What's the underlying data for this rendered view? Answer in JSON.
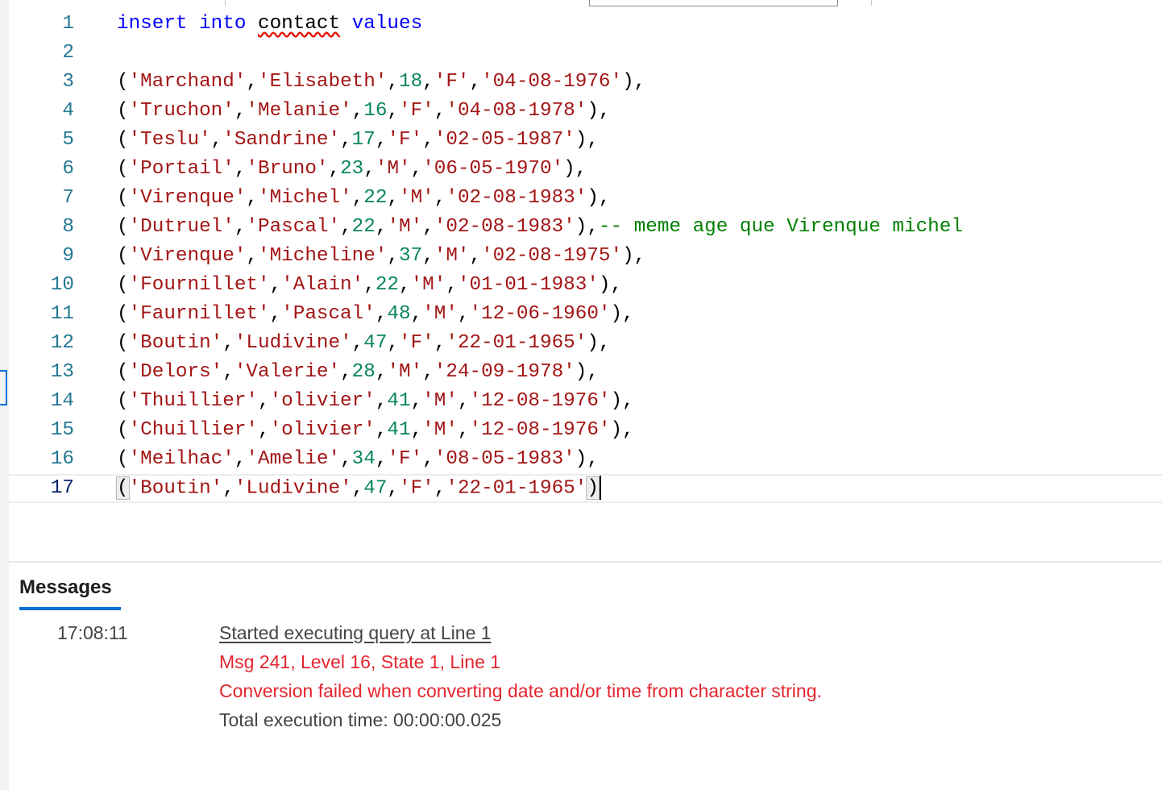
{
  "editor": {
    "current_line": 17,
    "lines": [
      {
        "n": "1",
        "tokens": [
          {
            "t": "insert",
            "c": "kw"
          },
          {
            "t": " ",
            "c": "plain"
          },
          {
            "t": "into",
            "c": "kw"
          },
          {
            "t": " ",
            "c": "plain"
          },
          {
            "t": "contact",
            "c": "plain squiggle"
          },
          {
            "t": " ",
            "c": "plain"
          },
          {
            "t": "values",
            "c": "kw"
          }
        ]
      },
      {
        "n": "2",
        "tokens": []
      },
      {
        "n": "3",
        "tokens": [
          {
            "t": "(",
            "c": "punc"
          },
          {
            "t": "'Marchand'",
            "c": "str"
          },
          {
            "t": ",",
            "c": "punc"
          },
          {
            "t": "'Elisabeth'",
            "c": "str"
          },
          {
            "t": ",",
            "c": "punc"
          },
          {
            "t": "18",
            "c": "num"
          },
          {
            "t": ",",
            "c": "punc"
          },
          {
            "t": "'F'",
            "c": "str"
          },
          {
            "t": ",",
            "c": "punc"
          },
          {
            "t": "'04-08-1976'",
            "c": "str"
          },
          {
            "t": "),",
            "c": "punc"
          }
        ]
      },
      {
        "n": "4",
        "tokens": [
          {
            "t": "(",
            "c": "punc"
          },
          {
            "t": "'Truchon'",
            "c": "str"
          },
          {
            "t": ",",
            "c": "punc"
          },
          {
            "t": "'Melanie'",
            "c": "str"
          },
          {
            "t": ",",
            "c": "punc"
          },
          {
            "t": "16",
            "c": "num"
          },
          {
            "t": ",",
            "c": "punc"
          },
          {
            "t": "'F'",
            "c": "str"
          },
          {
            "t": ",",
            "c": "punc"
          },
          {
            "t": "'04-08-1978'",
            "c": "str"
          },
          {
            "t": "),",
            "c": "punc"
          }
        ]
      },
      {
        "n": "5",
        "tokens": [
          {
            "t": "(",
            "c": "punc"
          },
          {
            "t": "'Teslu'",
            "c": "str"
          },
          {
            "t": ",",
            "c": "punc"
          },
          {
            "t": "'Sandrine'",
            "c": "str"
          },
          {
            "t": ",",
            "c": "punc"
          },
          {
            "t": "17",
            "c": "num"
          },
          {
            "t": ",",
            "c": "punc"
          },
          {
            "t": "'F'",
            "c": "str"
          },
          {
            "t": ",",
            "c": "punc"
          },
          {
            "t": "'02-05-1987'",
            "c": "str"
          },
          {
            "t": "),",
            "c": "punc"
          }
        ]
      },
      {
        "n": "6",
        "tokens": [
          {
            "t": "(",
            "c": "punc"
          },
          {
            "t": "'Portail'",
            "c": "str"
          },
          {
            "t": ",",
            "c": "punc"
          },
          {
            "t": "'Bruno'",
            "c": "str"
          },
          {
            "t": ",",
            "c": "punc"
          },
          {
            "t": "23",
            "c": "num"
          },
          {
            "t": ",",
            "c": "punc"
          },
          {
            "t": "'M'",
            "c": "str"
          },
          {
            "t": ",",
            "c": "punc"
          },
          {
            "t": "'06-05-1970'",
            "c": "str"
          },
          {
            "t": "),",
            "c": "punc"
          }
        ]
      },
      {
        "n": "7",
        "tokens": [
          {
            "t": "(",
            "c": "punc"
          },
          {
            "t": "'Virenque'",
            "c": "str"
          },
          {
            "t": ",",
            "c": "punc"
          },
          {
            "t": "'Michel'",
            "c": "str"
          },
          {
            "t": ",",
            "c": "punc"
          },
          {
            "t": "22",
            "c": "num"
          },
          {
            "t": ",",
            "c": "punc"
          },
          {
            "t": "'M'",
            "c": "str"
          },
          {
            "t": ",",
            "c": "punc"
          },
          {
            "t": "'02-08-1983'",
            "c": "str"
          },
          {
            "t": "),",
            "c": "punc"
          }
        ]
      },
      {
        "n": "8",
        "tokens": [
          {
            "t": "(",
            "c": "punc"
          },
          {
            "t": "'Dutruel'",
            "c": "str"
          },
          {
            "t": ",",
            "c": "punc"
          },
          {
            "t": "'Pascal'",
            "c": "str"
          },
          {
            "t": ",",
            "c": "punc"
          },
          {
            "t": "22",
            "c": "num"
          },
          {
            "t": ",",
            "c": "punc"
          },
          {
            "t": "'M'",
            "c": "str"
          },
          {
            "t": ",",
            "c": "punc"
          },
          {
            "t": "'02-08-1983'",
            "c": "str"
          },
          {
            "t": "),",
            "c": "punc"
          },
          {
            "t": "-- meme age que Virenque michel",
            "c": "comment"
          }
        ]
      },
      {
        "n": "9",
        "tokens": [
          {
            "t": "(",
            "c": "punc"
          },
          {
            "t": "'Virenque'",
            "c": "str"
          },
          {
            "t": ",",
            "c": "punc"
          },
          {
            "t": "'Micheline'",
            "c": "str"
          },
          {
            "t": ",",
            "c": "punc"
          },
          {
            "t": "37",
            "c": "num"
          },
          {
            "t": ",",
            "c": "punc"
          },
          {
            "t": "'M'",
            "c": "str"
          },
          {
            "t": ",",
            "c": "punc"
          },
          {
            "t": "'02-08-1975'",
            "c": "str"
          },
          {
            "t": "),",
            "c": "punc"
          }
        ]
      },
      {
        "n": "10",
        "tokens": [
          {
            "t": "(",
            "c": "punc"
          },
          {
            "t": "'Fournillet'",
            "c": "str"
          },
          {
            "t": ",",
            "c": "punc"
          },
          {
            "t": "'Alain'",
            "c": "str"
          },
          {
            "t": ",",
            "c": "punc"
          },
          {
            "t": "22",
            "c": "num"
          },
          {
            "t": ",",
            "c": "punc"
          },
          {
            "t": "'M'",
            "c": "str"
          },
          {
            "t": ",",
            "c": "punc"
          },
          {
            "t": "'01-01-1983'",
            "c": "str"
          },
          {
            "t": "),",
            "c": "punc"
          }
        ]
      },
      {
        "n": "11",
        "tokens": [
          {
            "t": "(",
            "c": "punc"
          },
          {
            "t": "'Faurnillet'",
            "c": "str"
          },
          {
            "t": ",",
            "c": "punc"
          },
          {
            "t": "'Pascal'",
            "c": "str"
          },
          {
            "t": ",",
            "c": "punc"
          },
          {
            "t": "48",
            "c": "num"
          },
          {
            "t": ",",
            "c": "punc"
          },
          {
            "t": "'M'",
            "c": "str"
          },
          {
            "t": ",",
            "c": "punc"
          },
          {
            "t": "'12-06-1960'",
            "c": "str"
          },
          {
            "t": "),",
            "c": "punc"
          }
        ]
      },
      {
        "n": "12",
        "tokens": [
          {
            "t": "(",
            "c": "punc"
          },
          {
            "t": "'Boutin'",
            "c": "str"
          },
          {
            "t": ",",
            "c": "punc"
          },
          {
            "t": "'Ludivine'",
            "c": "str"
          },
          {
            "t": ",",
            "c": "punc"
          },
          {
            "t": "47",
            "c": "num"
          },
          {
            "t": ",",
            "c": "punc"
          },
          {
            "t": "'F'",
            "c": "str"
          },
          {
            "t": ",",
            "c": "punc"
          },
          {
            "t": "'22-01-1965'",
            "c": "str"
          },
          {
            "t": "),",
            "c": "punc"
          }
        ]
      },
      {
        "n": "13",
        "tokens": [
          {
            "t": "(",
            "c": "punc"
          },
          {
            "t": "'Delors'",
            "c": "str"
          },
          {
            "t": ",",
            "c": "punc"
          },
          {
            "t": "'Valerie'",
            "c": "str"
          },
          {
            "t": ",",
            "c": "punc"
          },
          {
            "t": "28",
            "c": "num"
          },
          {
            "t": ",",
            "c": "punc"
          },
          {
            "t": "'M'",
            "c": "str"
          },
          {
            "t": ",",
            "c": "punc"
          },
          {
            "t": "'24-09-1978'",
            "c": "str"
          },
          {
            "t": "),",
            "c": "punc"
          }
        ]
      },
      {
        "n": "14",
        "tokens": [
          {
            "t": "(",
            "c": "punc"
          },
          {
            "t": "'Thuillier'",
            "c": "str"
          },
          {
            "t": ",",
            "c": "punc"
          },
          {
            "t": "'olivier'",
            "c": "str"
          },
          {
            "t": ",",
            "c": "punc"
          },
          {
            "t": "41",
            "c": "num"
          },
          {
            "t": ",",
            "c": "punc"
          },
          {
            "t": "'M'",
            "c": "str"
          },
          {
            "t": ",",
            "c": "punc"
          },
          {
            "t": "'12-08-1976'",
            "c": "str"
          },
          {
            "t": "),",
            "c": "punc"
          }
        ]
      },
      {
        "n": "15",
        "tokens": [
          {
            "t": "(",
            "c": "punc"
          },
          {
            "t": "'Chuillier'",
            "c": "str"
          },
          {
            "t": ",",
            "c": "punc"
          },
          {
            "t": "'olivier'",
            "c": "str"
          },
          {
            "t": ",",
            "c": "punc"
          },
          {
            "t": "41",
            "c": "num"
          },
          {
            "t": ",",
            "c": "punc"
          },
          {
            "t": "'M'",
            "c": "str"
          },
          {
            "t": ",",
            "c": "punc"
          },
          {
            "t": "'12-08-1976'",
            "c": "str"
          },
          {
            "t": "),",
            "c": "punc"
          }
        ]
      },
      {
        "n": "16",
        "tokens": [
          {
            "t": "(",
            "c": "punc"
          },
          {
            "t": "'Meilhac'",
            "c": "str"
          },
          {
            "t": ",",
            "c": "punc"
          },
          {
            "t": "'Amelie'",
            "c": "str"
          },
          {
            "t": ",",
            "c": "punc"
          },
          {
            "t": "34",
            "c": "num"
          },
          {
            "t": ",",
            "c": "punc"
          },
          {
            "t": "'F'",
            "c": "str"
          },
          {
            "t": ",",
            "c": "punc"
          },
          {
            "t": "'08-05-1983'",
            "c": "str"
          },
          {
            "t": "),",
            "c": "punc"
          }
        ]
      },
      {
        "n": "17",
        "tokens": [
          {
            "t": "(",
            "c": "punc bracket-match"
          },
          {
            "t": "'Boutin'",
            "c": "str"
          },
          {
            "t": ",",
            "c": "punc"
          },
          {
            "t": "'Ludivine'",
            "c": "str"
          },
          {
            "t": ",",
            "c": "punc"
          },
          {
            "t": "47",
            "c": "num"
          },
          {
            "t": ",",
            "c": "punc"
          },
          {
            "t": "'F'",
            "c": "str"
          },
          {
            "t": ",",
            "c": "punc"
          },
          {
            "t": "'22-01-1965'",
            "c": "str"
          },
          {
            "t": ")",
            "c": "punc bracket-match"
          }
        ]
      }
    ]
  },
  "messages": {
    "tab_label": "Messages",
    "time": "17:08:11",
    "started": "Started executing query at Line 1",
    "error_code": "Msg 241, Level 16, State 1, Line 1",
    "error_text": "Conversion failed when converting date and/or time from character string.",
    "exec_time": "Total execution time: 00:00:00.025"
  },
  "colors": {
    "keyword": "#0000ff",
    "string": "#a31515",
    "number": "#098658",
    "comment": "#008000",
    "line_number": "#237893",
    "error": "#e5252f",
    "accent": "#0a6fd6"
  }
}
